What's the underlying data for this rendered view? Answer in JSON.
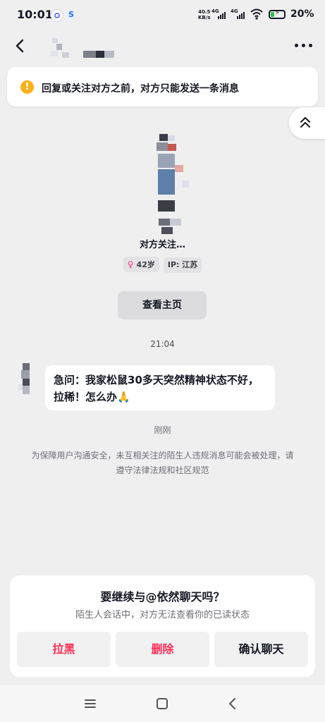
{
  "status_bar": {
    "time": "10:01",
    "net_speed_value": "40.5",
    "net_speed_unit": "KB/s",
    "signal_1": "4G",
    "signal_2": "4G",
    "battery": "20%"
  },
  "header": {
    "back_icon": "chevron-left-icon",
    "more_icon": "more-dots-icon"
  },
  "notice": {
    "icon": "!",
    "text": "回复或关注对方之前，对方只能发送一条消息"
  },
  "profile": {
    "name": "对方关注…",
    "age": "42岁",
    "ip": "IP: 江苏",
    "view_profile_label": "查看主页"
  },
  "chat": {
    "timestamp": "21:04",
    "message_line1": "急问：我家松鼠30多天突然精神状态不好，",
    "message_line2": "拉稀！怎么办🙏",
    "status": "刚刚",
    "safety_notice": "为保障用户沟通安全，未互相关注的陌生人违规消息可能会被处理，请遵守法律法规和社区规范"
  },
  "prompt": {
    "title": "要继续与@依然聊天吗？",
    "subtitle": "陌生人会话中，对方无法查看你的已读状态",
    "block_label": "拉黑",
    "delete_label": "删除",
    "confirm_label": "确认聊天"
  },
  "colors": {
    "accent_red": "#fe2c55",
    "warning": "#fbb117",
    "background": "#efeff0"
  }
}
